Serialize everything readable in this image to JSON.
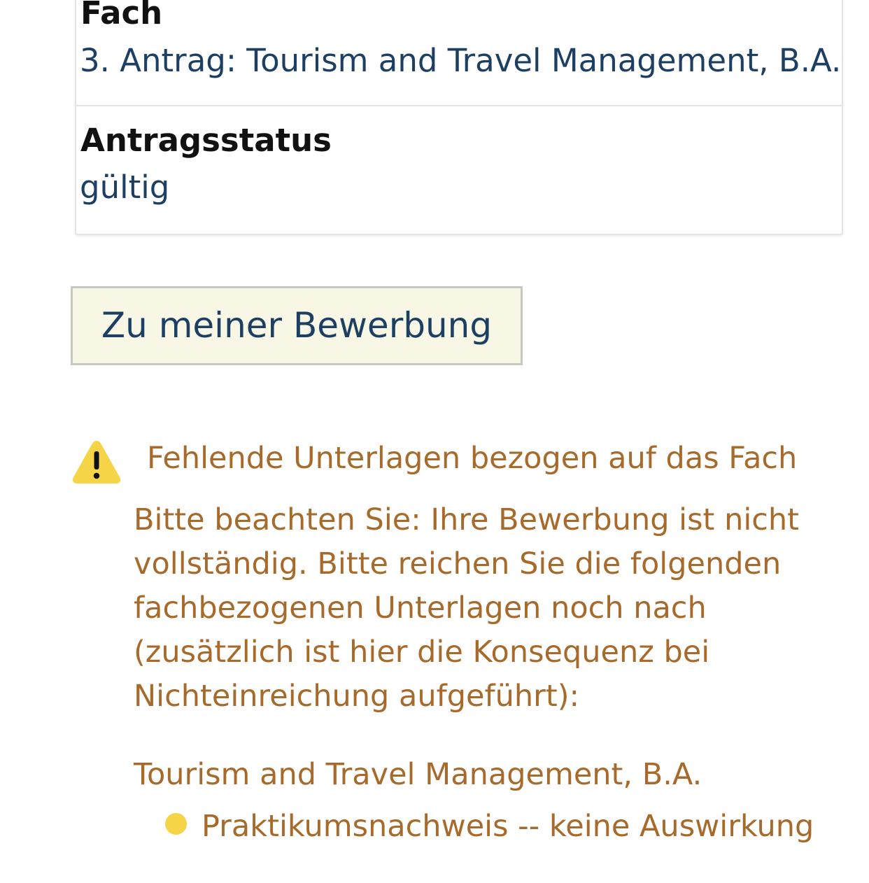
{
  "details": {
    "subject_label": "Fach",
    "subject_value": "3. Antrag: Tourism and Travel Management, B.A.",
    "status_label": "Antragsstatus",
    "status_value": "gültig"
  },
  "actions": {
    "application_button_label": "Zu meiner Bewerbung"
  },
  "missing_documents": {
    "icon": "warning-icon",
    "title": "Fehlende Unterlagen bezogen auf das Fach",
    "body_lines": [
      "Bitte beachten Sie: Ihre Bewerbung ist nicht",
      "vollständig. Bitte reichen Sie die folgenden",
      "fachbezogenen Unterlagen noch nach",
      "(zusätzlich ist hier die Konsequenz bei",
      "Nichteinreichung aufgeführt):"
    ],
    "subject": "Tourism and Travel Management, B.A.",
    "items": [
      {
        "bullet_color": "#f5d547",
        "text": "Praktikumsnachweis -- keine Auswirkung"
      }
    ]
  },
  "colors": {
    "link_blue": "#1c3f63",
    "warning_brown": "#a86a2a",
    "warning_yellow": "#f5d547",
    "button_background": "#f8f7e6"
  }
}
